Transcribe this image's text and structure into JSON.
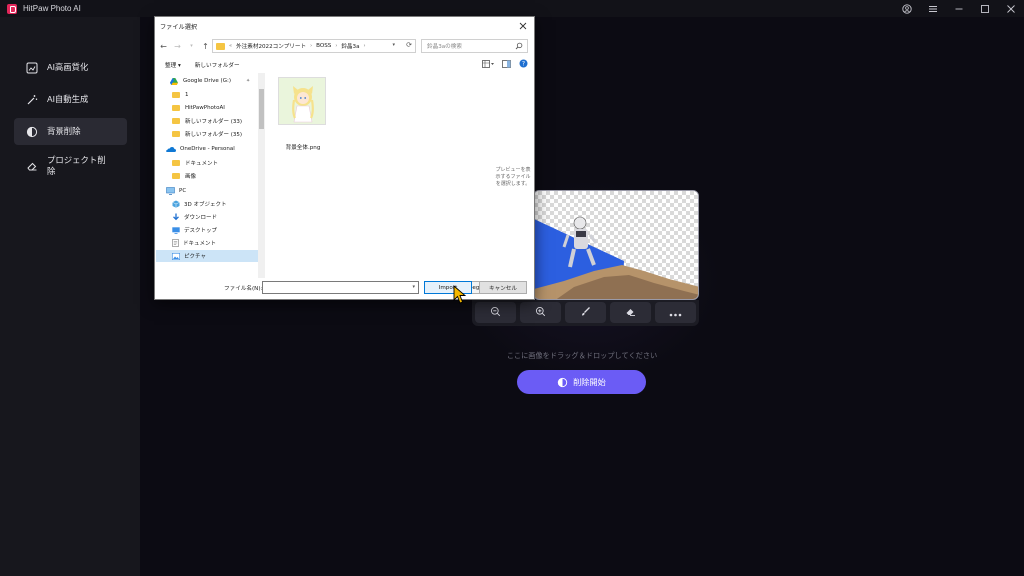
{
  "app": {
    "title": "HitPaw Photo AI",
    "brand_color": "#e2265a",
    "accent": "#6b5cf5"
  },
  "window_controls": [
    "user-icon",
    "menu-icon",
    "minimize-icon",
    "maximize-icon",
    "close-icon"
  ],
  "sidebar": {
    "items": [
      {
        "label": "AI高画質化",
        "icon": "enhance-icon",
        "active": false
      },
      {
        "label": "AI自動生成",
        "icon": "magic-wand-icon",
        "active": false
      },
      {
        "label": "背景削除",
        "icon": "background-remove-icon",
        "active": true
      },
      {
        "label": "プロジェクト削除",
        "icon": "eraser-icon",
        "active": false
      }
    ]
  },
  "main": {
    "toolbar_icons": [
      "zoom-out-icon",
      "zoom-in-icon",
      "brush-icon",
      "eraser-icon",
      "more-icon"
    ],
    "drop_hint": "ここに画像をドラッグ＆ドロップしてください",
    "start_button": "削除開始"
  },
  "dialog": {
    "title": "ファイル選択",
    "path": [
      "外注素材2022コンプリート",
      "BOSS",
      "鈴晶3a"
    ],
    "path_prefix": "«",
    "search_placeholder": "鈴晶3aの検索",
    "organize": "整理 ▾",
    "new_folder": "新しいフォルダー",
    "tree": [
      {
        "label": "Google Drive (G:)",
        "icon": "google-drive-icon"
      },
      {
        "label": "1",
        "icon": "folder-icon"
      },
      {
        "label": "HitPawPhotoAI",
        "icon": "folder-icon"
      },
      {
        "label": "新しいフォルダー (33)",
        "icon": "folder-icon"
      },
      {
        "label": "新しいフォルダー (35)",
        "icon": "folder-icon"
      },
      {
        "label": "OneDrive - Personal",
        "icon": "onedrive-icon"
      },
      {
        "label": "ドキュメント",
        "icon": "folder-icon"
      },
      {
        "label": "画像",
        "icon": "folder-icon"
      },
      {
        "label": "PC",
        "icon": "pc-icon"
      },
      {
        "label": "3D オブジェクト",
        "icon": "3d-objects-icon"
      },
      {
        "label": "ダウンロード",
        "icon": "download-icon"
      },
      {
        "label": "デスクトップ",
        "icon": "desktop-icon"
      },
      {
        "label": "ドキュメント",
        "icon": "documents-icon"
      },
      {
        "label": "ピクチャ",
        "icon": "pictures-icon"
      }
    ],
    "file": {
      "name": "背景全体.png"
    },
    "preview_text": "プレビューを表示するファイルを選択します。",
    "filename_label": "ファイル名(N):",
    "filename_value": "",
    "filetype": "image (*.jpg;*.jpeg;*.png;*.webp",
    "import": "Import",
    "cancel": "キャンセル"
  }
}
